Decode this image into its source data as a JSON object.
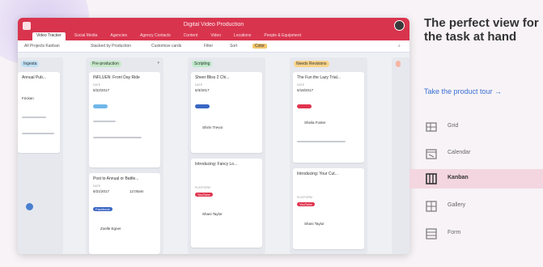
{
  "app": {
    "title": "Digital Video Production",
    "tabs": [
      "Video Tracker",
      "Social Media",
      "Agencies",
      "Agency Contacts",
      "Content",
      "Video",
      "Locations",
      "People & Equipment"
    ],
    "toolbar": [
      "All Projects Kanban",
      "Stacked by Production",
      "Customize cards",
      "Filter",
      "Sort",
      "Color"
    ]
  },
  "board": {
    "columns": [
      {
        "header": "Ingesta",
        "cards": [
          {
            "title": "Annual Pub...",
            "field": "",
            "value": "Fricken",
            "chip": "",
            "chip_color": ""
          }
        ]
      },
      {
        "header": "Pre-production",
        "cards": [
          {
            "title": "INFLUEN: Front Day Ride",
            "field": "DATE",
            "value": "5/22/2017",
            "chip": "",
            "chip_color": "#6fb7e8"
          },
          {
            "title": "Post to Annual or Battle...",
            "field": "DATE",
            "value": "6/21/2017",
            "value2": "12:00am",
            "chip": "Facebook",
            "chip_color": "#3b66c4",
            "lead": "Zoelle Egner"
          }
        ]
      },
      {
        "header": "Scripting",
        "cards": [
          {
            "title": "Sheer Bliss 2 Chi...",
            "field": "DATE",
            "value": "6/3/2017",
            "chip": "",
            "chip_color": "#3b66c4",
            "lead": "Shirin Trevor"
          },
          {
            "title": "Introducing: Fancy Lo...",
            "field": "PLATFORM",
            "value": "",
            "chip": "YouTube",
            "chip_color": "#e0344e",
            "lead": "Shani Taylor"
          }
        ]
      },
      {
        "header": "Needs Revisions",
        "cards": [
          {
            "title": "The Fun the Lazy Trial...",
            "field": "DATE",
            "value": "6/18/2017",
            "chip": "",
            "chip_color": "#e0344e",
            "lead": "Sheila Foster"
          },
          {
            "title": "Introducing: Your Cut...",
            "field": "PLATFORM",
            "value": "",
            "chip": "YouTube",
            "chip_color": "#e0344e",
            "lead": "Shani Taylor"
          }
        ]
      }
    ]
  },
  "panel": {
    "headline": "The perfect view for the task at hand",
    "tour_link": "Take the product tour →",
    "views": [
      "Grid",
      "Calendar",
      "Kanban",
      "Gallery",
      "Form"
    ],
    "active_view": "Kanban"
  },
  "colors": {
    "topbar": "#d9344e",
    "accent": "#3b6fd4",
    "active_view_bg": "#f3d6df"
  }
}
